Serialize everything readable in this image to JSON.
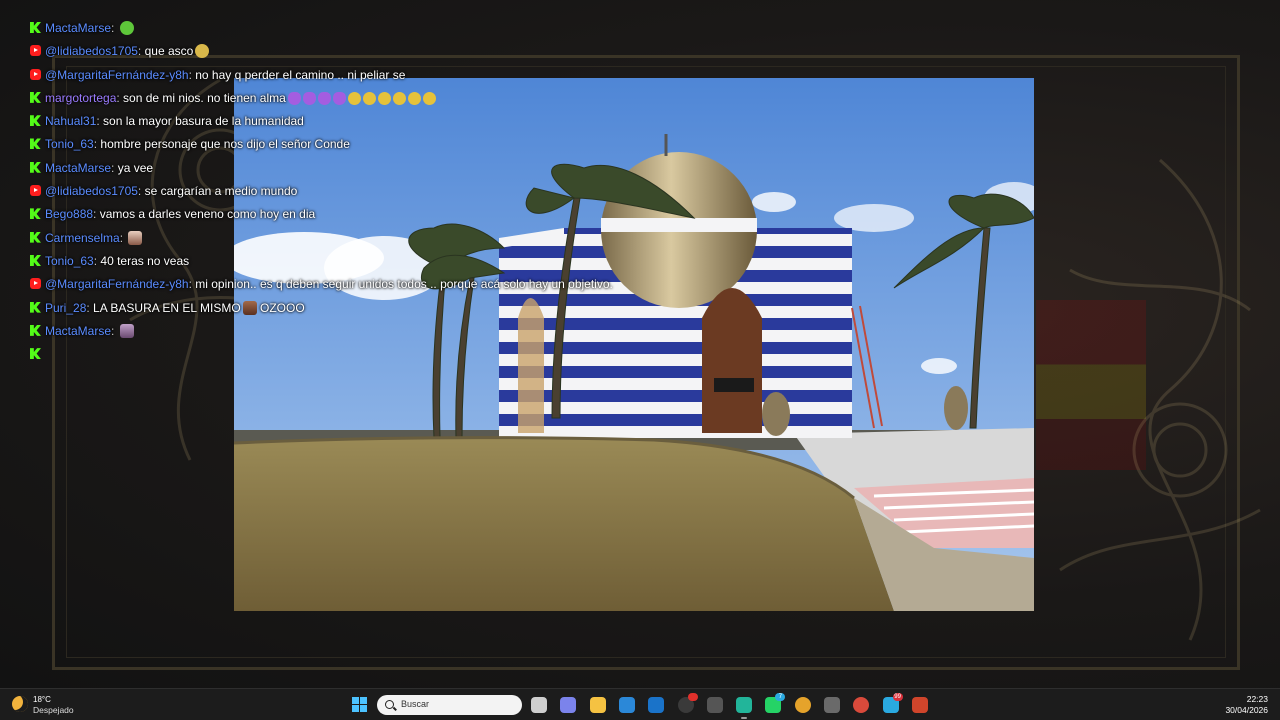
{
  "chat": {
    "messages": [
      {
        "platform": "kick",
        "user": "MactaMarse",
        "text": "",
        "emotes": [
          "green-face"
        ]
      },
      {
        "platform": "youtube",
        "user": "@lidiabedos1705",
        "text": "que asco",
        "emotes": [
          "sick-face"
        ]
      },
      {
        "platform": "youtube",
        "user": "@MargaritaFernández-y8h",
        "text": "no hay q perder el camino .. ni peliar se",
        "emotes": []
      },
      {
        "platform": "kick",
        "user": "margotortega",
        "text": "son de mi nios. no tienen alma",
        "emotes": [
          "imp",
          "imp",
          "imp",
          "imp",
          "tired",
          "tired",
          "tired",
          "tired",
          "tired",
          "tired"
        ]
      },
      {
        "platform": "kick",
        "user": "Nahual31",
        "text": "son la mayor basura de la humanidad",
        "emotes": []
      },
      {
        "platform": "kick",
        "user": "Tonio_63",
        "text": "hombre personaje que nos dijo el señor Conde",
        "emotes": []
      },
      {
        "platform": "kick",
        "user": "MactaMarse",
        "text": "ya vee",
        "emotes": []
      },
      {
        "platform": "youtube",
        "user": "@lidiabedos1705",
        "text": "se cargarían a medio mundo",
        "emotes": []
      },
      {
        "platform": "kick",
        "user": "Bego888",
        "text": "vamos a darles veneno como hoy en dia",
        "emotes": []
      },
      {
        "platform": "kick",
        "user": "Carmenselma",
        "text": "",
        "emotes": [
          "photo"
        ]
      },
      {
        "platform": "kick",
        "user": "Tonio_63",
        "text": "40 teras no veas",
        "emotes": []
      },
      {
        "platform": "youtube",
        "user": "@MargaritaFernández-y8h",
        "text": "mi opinion.. es q deben seguir unidos todos .. porque acá solo hay un objetivo.",
        "emotes": []
      },
      {
        "platform": "kick",
        "user": "Puri_28",
        "text": "LA BASURA EN EL MISMO",
        "emotes": [
          "face"
        ],
        "suffix": "OZOOO"
      },
      {
        "platform": "kick",
        "user": "MactaMarse",
        "text": "",
        "emotes": [
          "face2"
        ]
      }
    ]
  },
  "taskbar": {
    "weather_temp": "18°C",
    "weather_desc": "Despejado",
    "search_placeholder": "Buscar",
    "time": "22:23",
    "date": "30/04/2026",
    "apps": [
      {
        "name": "task-view",
        "color": "#cfcfcf"
      },
      {
        "name": "teams",
        "color": "#7b83eb"
      },
      {
        "name": "file-explorer",
        "color": "#f5c242"
      },
      {
        "name": "store",
        "color": "#2b88d8"
      },
      {
        "name": "outlook",
        "color": "#1a73c9"
      },
      {
        "name": "obs",
        "color": "#3a3a3a",
        "badge": "",
        "badge_color": "#e0302b"
      },
      {
        "name": "unity",
        "color": "#555555"
      },
      {
        "name": "edge",
        "color": "#22b59a",
        "active": true
      },
      {
        "name": "whatsapp",
        "color": "#25d366",
        "badge": "7",
        "badge_color": "#2aa9e0"
      },
      {
        "name": "chrome",
        "color": "#e5a32b"
      },
      {
        "name": "vmware",
        "color": "#6a6a6a"
      },
      {
        "name": "chrome-alt",
        "color": "#d94a3b"
      },
      {
        "name": "telegram",
        "color": "#2aa9e0",
        "badge": "99",
        "badge_color": "#d9303a"
      },
      {
        "name": "powerpoint",
        "color": "#d0452b"
      }
    ]
  },
  "colors": {
    "kick_green": "#53fc18",
    "youtube_blue": "#5b8cff",
    "youtube_red": "#ff1e1e"
  }
}
